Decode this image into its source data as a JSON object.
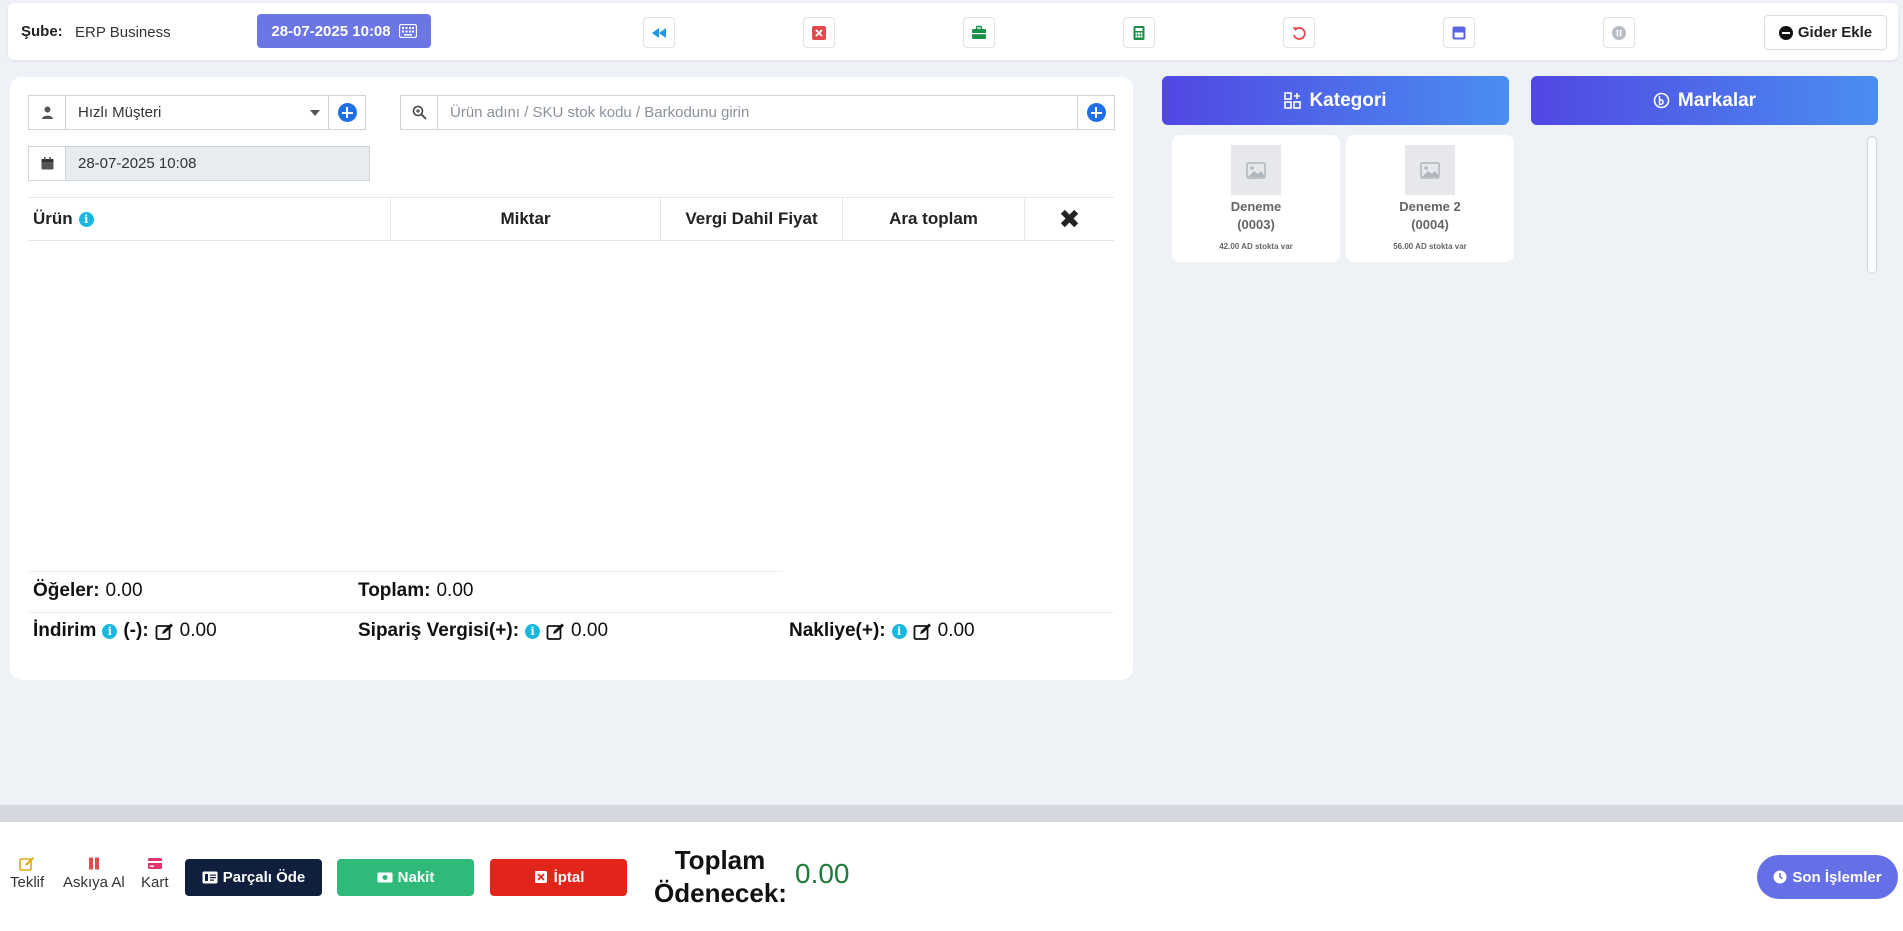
{
  "header": {
    "branch_label": "Şube:",
    "branch_value": "ERP Business",
    "datetime": "28-07-2025 10:08",
    "toolbar_icons": [
      "rewind-icon",
      "close-square-icon",
      "briefcase-icon",
      "calculator-icon",
      "undo-icon",
      "window-icon",
      "pause-icon"
    ],
    "gider_label": "Gider Ekle"
  },
  "form": {
    "customer": "Hızlı Müşteri",
    "search_placeholder": "Ürün adını / SKU stok kodu / Barkodunu girin",
    "date": "28-07-2025 10:08"
  },
  "table": {
    "headers": {
      "product": "Ürün",
      "quantity": "Miktar",
      "price": "Vergi Dahil Fiyat",
      "subtotal": "Ara toplam",
      "remove": "✖"
    }
  },
  "summary": {
    "items_label": "Öğeler:",
    "items_value": "0.00",
    "total_label": "Toplam:",
    "total_value": "0.00",
    "discount_label": "İndirim",
    "discount_suffix": "(-):",
    "discount_value": "0.00",
    "order_tax_label": "Sipariş Vergisi(+):",
    "order_tax_value": "0.00",
    "shipping_label": "Nakliye(+):",
    "shipping_value": "0.00"
  },
  "right": {
    "category_label": "Kategori",
    "brands_label": "Markalar",
    "products": [
      {
        "name": "Deneme",
        "code": "(0003)",
        "stock": "42.00 AD stokta var"
      },
      {
        "name": "Deneme 2",
        "code": "(0004)",
        "stock": "56.00 AD stokta var"
      }
    ]
  },
  "footer": {
    "teklif": "Teklif",
    "askiya": "Askıya Al",
    "kart": "Kart",
    "parcali": "Parçalı Öde",
    "nakit": "Nakit",
    "iptal": "İptal",
    "toplam_line1": "Toplam",
    "toplam_line2": "Ödenecek:",
    "toplam_value": "0.00",
    "son_islemler": "Son İşlemler"
  },
  "colors": {
    "primary": "#6c75e4",
    "kategori_gradient_start": "#5147e3",
    "kategori_gradient_end": "#4a8ef0",
    "parcali": "#0f1f3d",
    "nakit": "#2fba7a",
    "iptal": "#e1251b",
    "total_green": "#1f7a3b"
  }
}
